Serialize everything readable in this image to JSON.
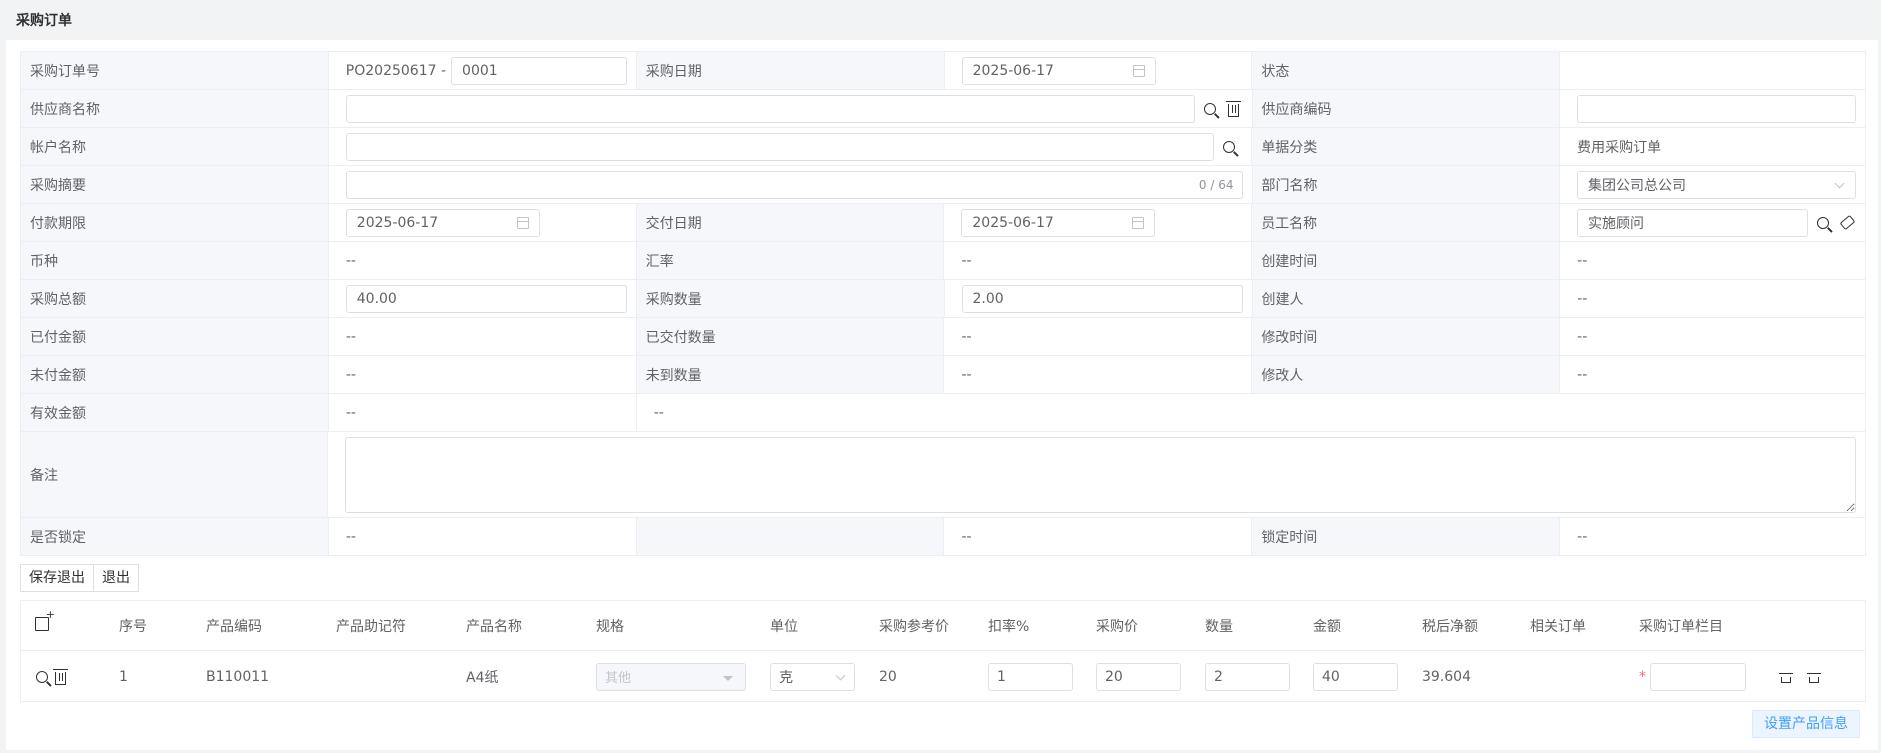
{
  "page": {
    "title": "采购订单"
  },
  "form": {
    "order_no_label": "采购订单号",
    "order_no_prefix": "PO20250617 -",
    "order_no_suffix": "0001",
    "order_date_label": "采购日期",
    "order_date": "2025-06-17",
    "status_label": "状态",
    "status_value": "",
    "supplier_name_label": "供应商名称",
    "supplier_name_value": "",
    "supplier_code_label": "供应商编码",
    "supplier_code_value": "",
    "account_name_label": "帐户名称",
    "account_name_value": "",
    "doc_category_label": "单据分类",
    "doc_category_value": "费用采购订单",
    "summary_label": "采购摘要",
    "summary_counter": "0 / 64",
    "dept_label": "部门名称",
    "dept_value": "集团公司总公司",
    "pay_term_label": "付款期限",
    "pay_term_date": "2025-06-17",
    "delivery_date_label": "交付日期",
    "delivery_date": "2025-06-17",
    "employee_label": "员工名称",
    "employee_value": "实施顾问",
    "currency_label": "币种",
    "currency_value": "--",
    "rate_label": "汇率",
    "rate_value": "--",
    "created_time_label": "创建时间",
    "created_time_value": "--",
    "total_amount_label": "采购总额",
    "total_amount_value": "40.00",
    "quantity_label": "采购数量",
    "quantity_value": "2.00",
    "creator_label": "创建人",
    "creator_value": "--",
    "paid_amount_label": "已付金额",
    "paid_amount_value": "--",
    "delivered_qty_label": "已交付数量",
    "delivered_qty_value": "--",
    "modified_time_label": "修改时间",
    "modified_time_value": "--",
    "unpaid_amount_label": "未付金额",
    "unpaid_amount_value": "--",
    "undelivered_qty_label": "未到数量",
    "undelivered_qty_value": "--",
    "modifier_label": "修改人",
    "modifier_value": "--",
    "valid_amount_label": "有效金额",
    "valid_amount_value": "--",
    "valid_amount_extra": "--",
    "remark_label": "备注",
    "remark_value": "",
    "locked_label": "是否锁定",
    "locked_value": "--",
    "locked_extra": "--",
    "lock_time_label": "锁定时间",
    "lock_time_value": "--"
  },
  "buttons": {
    "save_exit": "保存退出",
    "exit": "退出",
    "set_product": "设置产品信息"
  },
  "table": {
    "headers": {
      "seq": "序号",
      "code": "产品编码",
      "mnemonic": "产品助记符",
      "name": "产品名称",
      "spec": "规格",
      "unit": "单位",
      "ref_price": "采购参考价",
      "discount": "扣率%",
      "price": "采购价",
      "qty": "数量",
      "amount": "金额",
      "net": "税后净额",
      "related": "相关订单",
      "column": "采购订单栏目"
    },
    "rows": [
      {
        "seq": "1",
        "code": "B110011",
        "mnemonic": "",
        "name": "A4纸",
        "spec": "其他",
        "unit": "克",
        "ref_price": "20",
        "discount": "1",
        "price": "20",
        "qty": "2",
        "amount": "40",
        "net": "39.604",
        "related": "",
        "column": ""
      }
    ]
  }
}
